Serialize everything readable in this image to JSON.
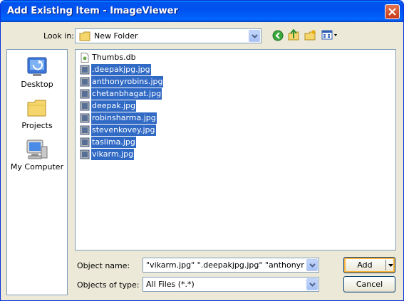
{
  "window": {
    "title": "Add Existing Item - ImageViewer"
  },
  "lookin": {
    "label": "Look in:",
    "value": "New Folder"
  },
  "toolbar": {
    "icons": [
      "back-icon",
      "up-folder-icon",
      "new-folder-icon",
      "views-icon"
    ]
  },
  "places": [
    {
      "label": "Desktop",
      "icon": "desktop-icon"
    },
    {
      "label": "Projects",
      "icon": "folder-icon"
    },
    {
      "label": "My Computer",
      "icon": "my-computer-icon"
    }
  ],
  "files": [
    {
      "name": "Thumbs.db",
      "selected": false
    },
    {
      "name": ".deepakjpg.jpg",
      "selected": true
    },
    {
      "name": "anthonyrobins.jpg",
      "selected": true
    },
    {
      "name": "chetanbhagat.jpg",
      "selected": true
    },
    {
      "name": "deepak.jpg",
      "selected": true
    },
    {
      "name": "robinsharma.jpg",
      "selected": true
    },
    {
      "name": "stevenkovey.jpg",
      "selected": true
    },
    {
      "name": "taslima.jpg",
      "selected": true
    },
    {
      "name": "vikarm.jpg",
      "selected": true
    }
  ],
  "object_name": {
    "label": "Object name:",
    "value": "\"vikarm.jpg\" \".deepakjpg.jpg\" \"anthonyrobins.j"
  },
  "object_type": {
    "label": "Objects of type:",
    "value": "All Files (*.*)"
  },
  "buttons": {
    "add": "Add",
    "cancel": "Cancel"
  },
  "colors": {
    "title_bar": "#0054e3",
    "selection": "#316ac5",
    "dialog_bg": "#ece9d8"
  }
}
